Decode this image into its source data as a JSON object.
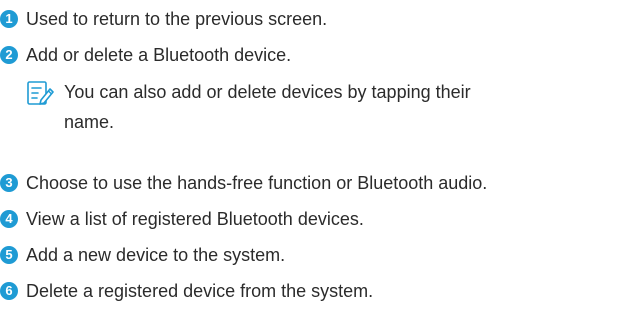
{
  "items": [
    {
      "number": "1",
      "text": "Used to return to the previous screen."
    },
    {
      "number": "2",
      "text": "Add or delete a Bluetooth device."
    },
    {
      "number": "3",
      "text": "Choose to use the hands-free function or Bluetooth audio."
    },
    {
      "number": "4",
      "text": "View a list of registered Bluetooth devices."
    },
    {
      "number": "5",
      "text": "Add a new device to the system."
    },
    {
      "number": "6",
      "text": "Delete a registered device from the system."
    }
  ],
  "note": {
    "icon": "note-icon",
    "text": "You can also add or delete devices by tapping their name."
  },
  "colors": {
    "badge": "#1f9bd4",
    "text": "#2b2b2b",
    "icon": "#1f9bd4"
  }
}
